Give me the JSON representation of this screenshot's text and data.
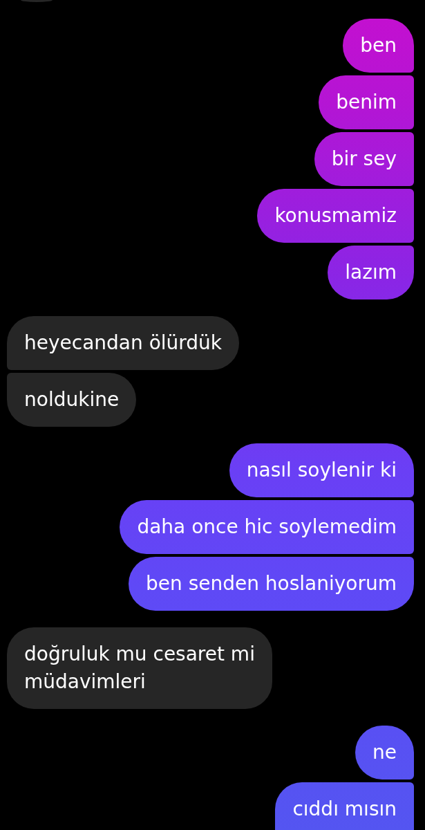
{
  "clipped_top": {
    "kind": "received"
  },
  "groups": [
    {
      "kind": "sent",
      "messages": [
        {
          "text": "ben"
        },
        {
          "text": "benim"
        },
        {
          "text": "bir sey"
        },
        {
          "text": "konusmamiz"
        },
        {
          "text": "lazım"
        }
      ]
    },
    {
      "kind": "received",
      "messages": [
        {
          "text": "heyecandan ölürdük"
        },
        {
          "text": "noldukine"
        }
      ]
    },
    {
      "kind": "sent",
      "messages": [
        {
          "text": "nasıl soylenir ki"
        },
        {
          "text": "daha once hic soylemedim"
        },
        {
          "text": "ben senden hoslaniyorum"
        }
      ]
    },
    {
      "kind": "received",
      "messages": [
        {
          "text": "doğruluk mu cesaret mi müdavimleri"
        }
      ]
    },
    {
      "kind": "sent",
      "messages": [
        {
          "text": "ne"
        },
        {
          "text": "cıddı mısın"
        }
      ]
    }
  ]
}
